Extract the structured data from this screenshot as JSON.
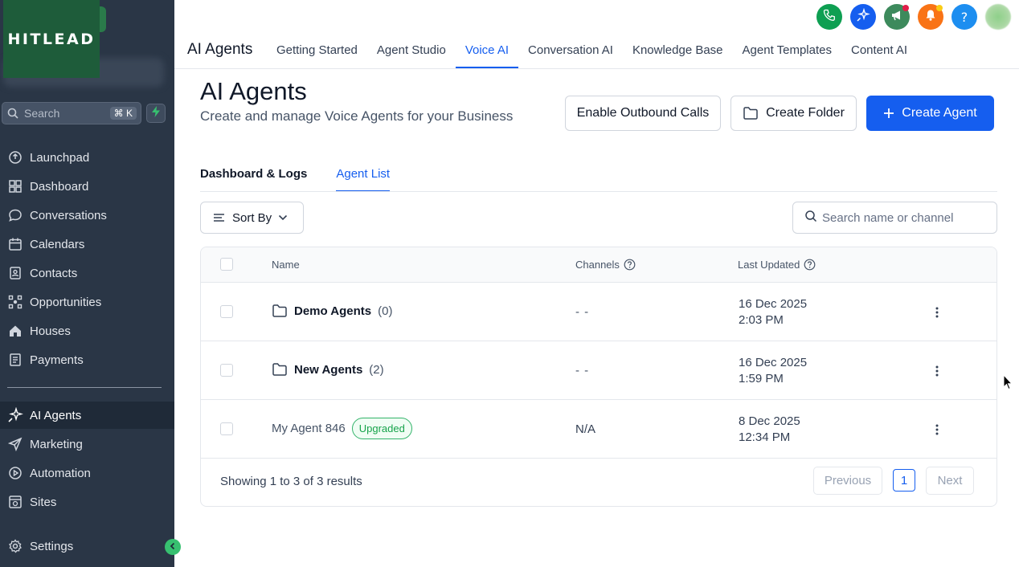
{
  "brand": {
    "logo_text": "HITLEAD"
  },
  "sidebar": {
    "search_placeholder": "Search",
    "search_shortcut": "⌘ K",
    "items": [
      {
        "label": "Launchpad",
        "icon": "launchpad-icon"
      },
      {
        "label": "Dashboard",
        "icon": "dashboard-icon"
      },
      {
        "label": "Conversations",
        "icon": "chat-icon"
      },
      {
        "label": "Calendars",
        "icon": "calendar-icon"
      },
      {
        "label": "Contacts",
        "icon": "contacts-icon"
      },
      {
        "label": "Opportunities",
        "icon": "opportunities-icon"
      },
      {
        "label": "Houses",
        "icon": "house-icon"
      },
      {
        "label": "Payments",
        "icon": "payments-icon"
      }
    ],
    "items2": [
      {
        "label": "AI Agents",
        "icon": "sparkle-icon",
        "active": true
      },
      {
        "label": "Marketing",
        "icon": "send-icon"
      },
      {
        "label": "Automation",
        "icon": "automation-icon"
      },
      {
        "label": "Sites",
        "icon": "sites-icon"
      }
    ],
    "settings_label": "Settings"
  },
  "topbar": {
    "app_title": "AI Agents",
    "tabs": [
      {
        "label": "Getting Started"
      },
      {
        "label": "Agent Studio"
      },
      {
        "label": "Voice AI",
        "active": true
      },
      {
        "label": "Conversation AI"
      },
      {
        "label": "Knowledge Base"
      },
      {
        "label": "Agent Templates"
      },
      {
        "label": "Content AI"
      }
    ],
    "icon_buttons": [
      {
        "icon": "phone-icon",
        "color": "#0e9f52"
      },
      {
        "icon": "sparkle-icon",
        "color": "#155eef"
      },
      {
        "icon": "megaphone-icon",
        "color": "#3d8a5c"
      },
      {
        "icon": "bell-icon",
        "color": "#f97316"
      },
      {
        "icon": "help-icon",
        "color": "#1d8ef0"
      }
    ]
  },
  "page": {
    "title": "AI Agents",
    "subtitle": "Create and manage Voice Agents for your Business",
    "buttons": {
      "outbound": "Enable Outbound Calls",
      "create_folder": "Create Folder",
      "create_agent": "Create Agent"
    },
    "subtabs": [
      {
        "label": "Dashboard & Logs"
      },
      {
        "label": "Agent List",
        "active": true
      }
    ],
    "sort_label": "Sort By",
    "search_placeholder": "Search name or channel"
  },
  "table": {
    "columns": {
      "name": "Name",
      "channels": "Channels",
      "last_updated": "Last Updated"
    },
    "rows": [
      {
        "type": "folder",
        "name": "Demo Agents",
        "count": "(0)",
        "channels": "- -",
        "date": "16 Dec 2025",
        "time": "2:03 PM"
      },
      {
        "type": "folder",
        "name": "New Agents",
        "count": "(2)",
        "channels": "- -",
        "date": "16 Dec 2025",
        "time": "1:59 PM"
      },
      {
        "type": "agent",
        "name": "My Agent 846",
        "badge": "Upgraded",
        "channels": "N/A",
        "date": "8 Dec 2025",
        "time": "12:34 PM"
      }
    ],
    "footer": {
      "summary": "Showing 1 to 3 of 3 results",
      "previous": "Previous",
      "page": "1",
      "next": "Next"
    }
  },
  "colors": {
    "sidebar_bg": "#2a3646",
    "accent": "#155eef",
    "badge_green": "#16a34a"
  }
}
